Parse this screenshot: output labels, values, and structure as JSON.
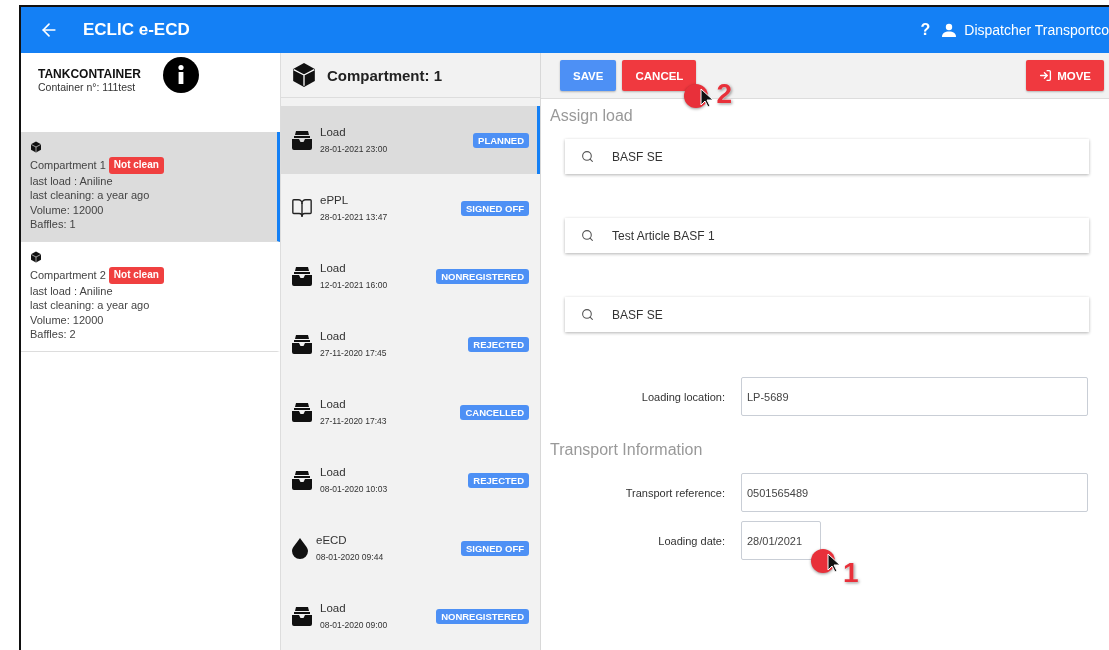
{
  "app_bar": {
    "title": "ECLIC e-ECD",
    "help": "?",
    "user": "Dispatcher Transportco"
  },
  "container": {
    "title": "TANKCONTAINER",
    "number": "Container n°: 111test"
  },
  "compartments": [
    {
      "name": "Compartment 1",
      "badge": "Not clean",
      "lines": [
        "last load : Aniline",
        "last cleaning: a year ago",
        "Volume: 12000",
        "Baffles: 1"
      ],
      "selected": true
    },
    {
      "name": "Compartment 2",
      "badge": "Not clean",
      "lines": [
        "last load : Aniline",
        "last cleaning: a year ago",
        "Volume: 12000",
        "Baffles: 2"
      ],
      "selected": false
    }
  ],
  "events_header": "Compartment: 1",
  "events": [
    {
      "kind": "load",
      "title": "Load",
      "date": "28-01-2021 23:00",
      "status": "PLANNED",
      "selected": true
    },
    {
      "kind": "eppl",
      "title": "ePPL",
      "date": "28-01-2021 13:47",
      "status": "SIGNED OFF",
      "selected": false
    },
    {
      "kind": "load",
      "title": "Load",
      "date": "12-01-2021 16:00",
      "status": "NONREGISTERED",
      "selected": false
    },
    {
      "kind": "load",
      "title": "Load",
      "date": "27-11-2020 17:45",
      "status": "REJECTED",
      "selected": false
    },
    {
      "kind": "load",
      "title": "Load",
      "date": "27-11-2020 17:43",
      "status": "CANCELLED",
      "selected": false
    },
    {
      "kind": "load",
      "title": "Load",
      "date": "08-01-2020 10:03",
      "status": "REJECTED",
      "selected": false
    },
    {
      "kind": "eecd",
      "title": "eECD",
      "date": "08-01-2020 09:44",
      "status": "SIGNED OFF",
      "selected": false
    },
    {
      "kind": "load",
      "title": "Load",
      "date": "08-01-2020 09:00",
      "status": "NONREGISTERED",
      "selected": false
    }
  ],
  "toolbar": {
    "save": "SAVE",
    "cancel": "CANCEL",
    "move": "MOVE",
    "cancel_callout": "2"
  },
  "assign_load": {
    "heading": "Assign load",
    "searches": [
      "BASF SE",
      "Test Article BASF 1",
      "BASF SE"
    ],
    "loading_location": {
      "label": "Loading location:",
      "value": "LP-5689"
    }
  },
  "transport": {
    "heading": "Transport Information",
    "reference": {
      "label": "Transport reference:",
      "value": "0501565489"
    },
    "date": {
      "label": "Loading date:",
      "value": "28/01/2021",
      "callout": "1"
    }
  }
}
